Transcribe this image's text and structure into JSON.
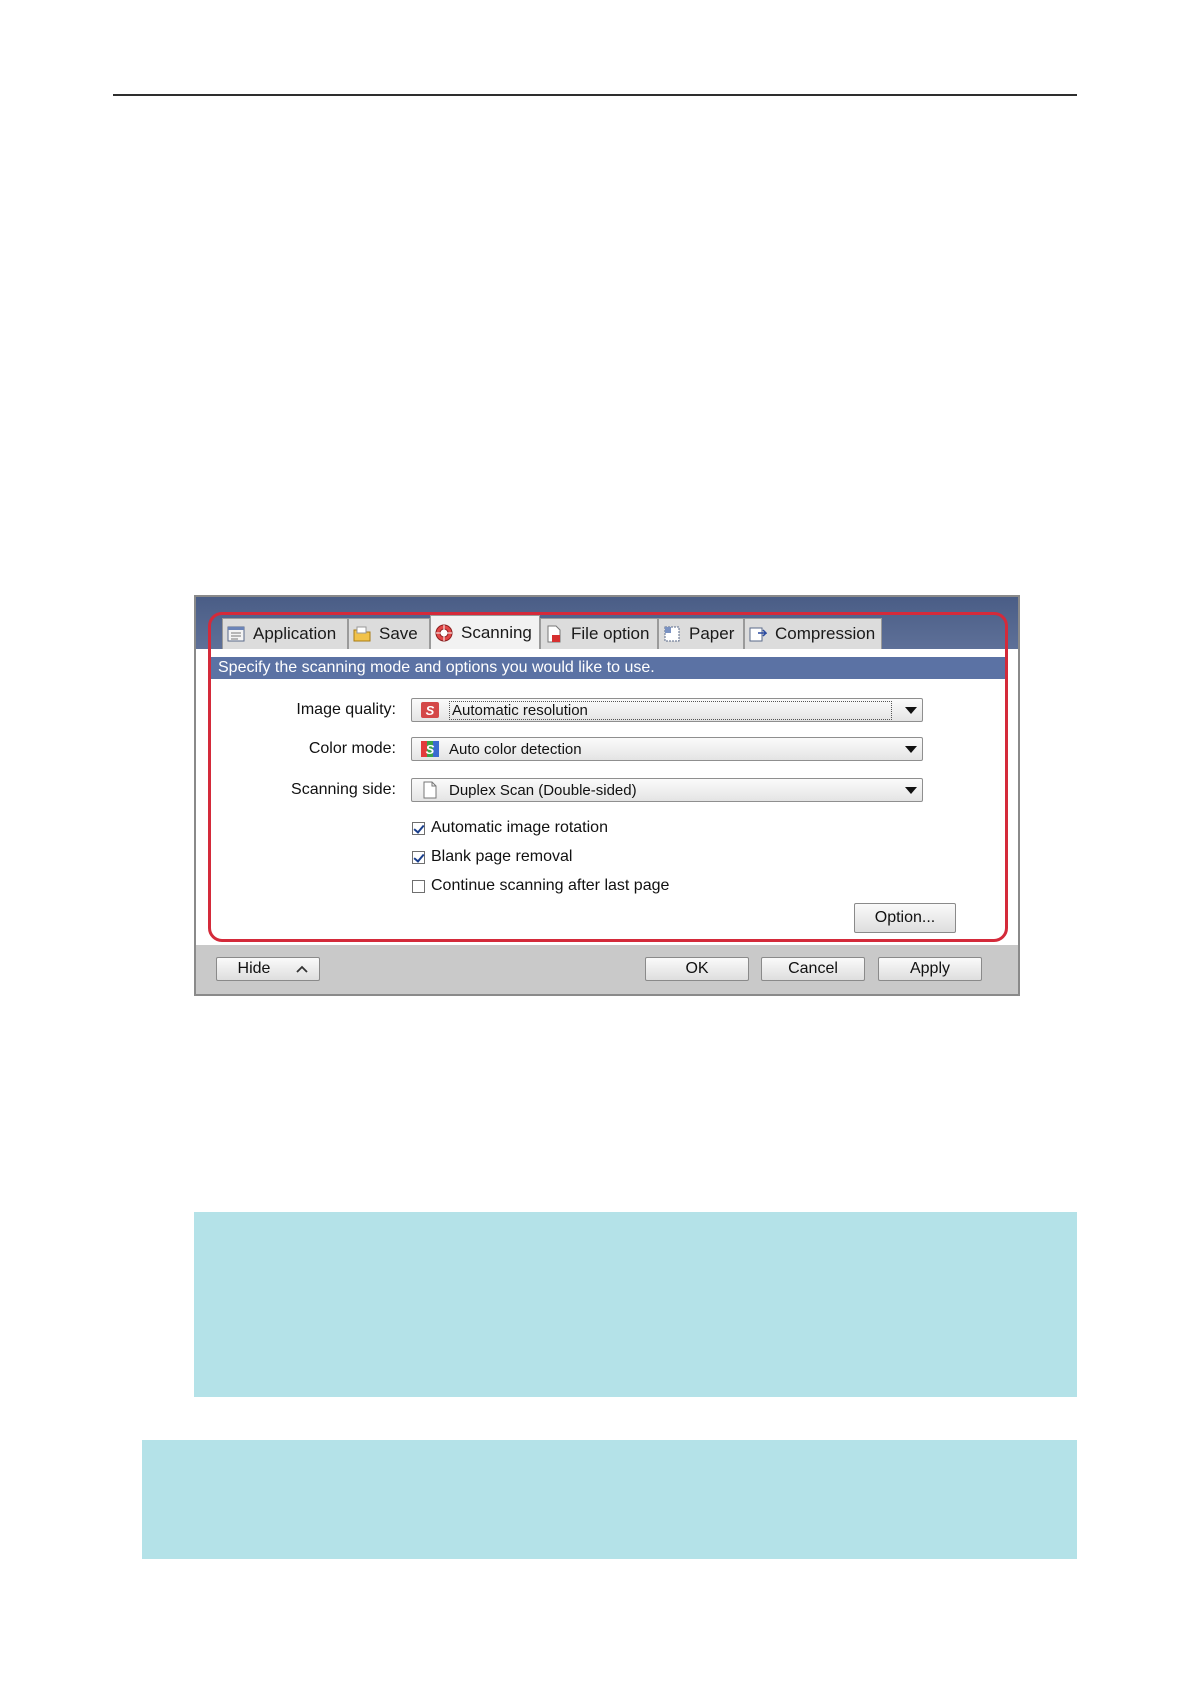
{
  "dialog": {
    "tabs": [
      {
        "label": "Application",
        "icon": "application-icon"
      },
      {
        "label": "Save",
        "icon": "save-folder-icon"
      },
      {
        "label": "Scanning",
        "icon": "scanning-icon",
        "active": true
      },
      {
        "label": "File option",
        "icon": "file-option-icon"
      },
      {
        "label": "Paper",
        "icon": "paper-icon"
      },
      {
        "label": "Compression",
        "icon": "compression-icon"
      }
    ],
    "banner": "Specify the scanning mode and options you would like to use.",
    "fields": {
      "image_quality": {
        "label": "Image quality:",
        "value": "Automatic resolution"
      },
      "color_mode": {
        "label": "Color mode:",
        "value": "Auto color detection"
      },
      "scanning_side": {
        "label": "Scanning side:",
        "value": "Duplex Scan (Double-sided)"
      }
    },
    "options": [
      {
        "label": "Automatic image rotation",
        "checked": true
      },
      {
        "label": "Blank page removal",
        "checked": true
      },
      {
        "label": "Continue scanning after last page",
        "checked": false
      }
    ],
    "option_button": "Option...",
    "footer": {
      "hide_label": "Hide",
      "ok_label": "OK",
      "cancel_label": "Cancel",
      "apply_label": "Apply"
    }
  },
  "colors": {
    "tabstrip": "#4a5d86",
    "banner": "#5b72a4",
    "highlight": "#d42a3a",
    "note_box": "#b4e2e8"
  }
}
